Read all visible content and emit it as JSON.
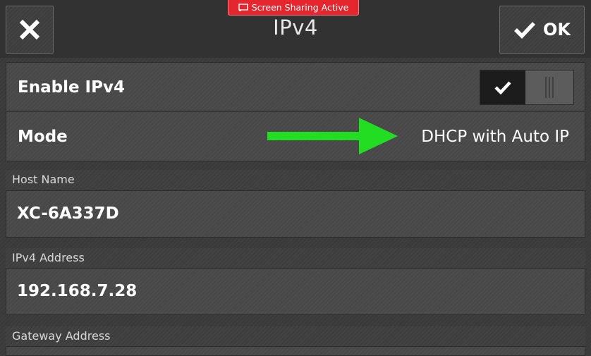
{
  "header": {
    "title": "IPv4",
    "ok_label": "OK",
    "screen_sharing_badge": "Screen Sharing Active"
  },
  "settings": {
    "enable_ipv4": {
      "label": "Enable IPv4",
      "enabled": true
    },
    "mode": {
      "label": "Mode",
      "value": "DHCP with Auto IP"
    }
  },
  "fields": {
    "host_name": {
      "label": "Host Name",
      "value": "XC-6A337D"
    },
    "ipv4_address": {
      "label": "IPv4 Address",
      "value": "192.168.7.28"
    },
    "gateway_address": {
      "label": "Gateway Address"
    }
  },
  "icons": {
    "close": "close-icon",
    "ok_check": "checkmark-icon",
    "toggle_check": "checkmark-icon",
    "screen_share": "screen-share-icon",
    "annotation_arrow": "arrow-right-icon"
  },
  "colors": {
    "badge": "#e5262f",
    "arrow": "#22dd22",
    "background": "#3a3a3a"
  }
}
